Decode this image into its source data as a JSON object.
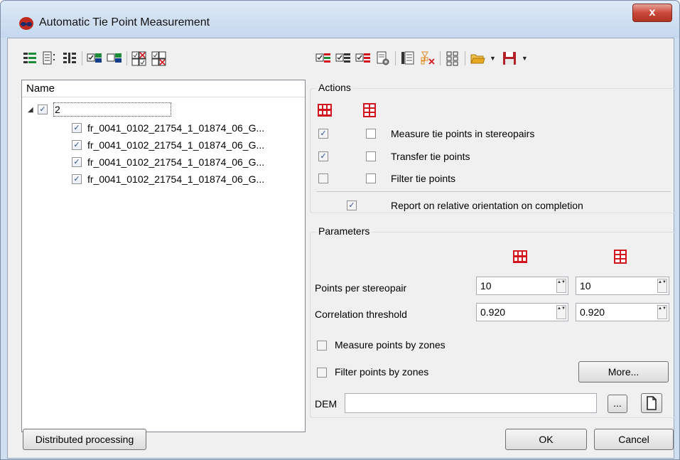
{
  "window": {
    "title": "Automatic Tie Point Measurement",
    "close_label": "x"
  },
  "tree": {
    "header": "Name",
    "root": {
      "label": "2",
      "checked": true,
      "expander": "◢"
    },
    "items": [
      {
        "label": "fr_0041_0102_21754_1_01874_06_G...",
        "checked": true
      },
      {
        "label": "fr_0041_0102_21754_1_01874_06_G...",
        "checked": true
      },
      {
        "label": "fr_0041_0102_21754_1_01874_06_G...",
        "checked": true
      },
      {
        "label": "fr_0041_0102_21754_1_01874_06_G...",
        "checked": true
      }
    ]
  },
  "actions": {
    "title": "Actions",
    "check_mark": "✓",
    "rows": [
      {
        "label": "Measure tie points in stereopairs",
        "col1": true,
        "col2": false
      },
      {
        "label": "Transfer tie points",
        "col1": true,
        "col2": false
      },
      {
        "label": "Filter tie points",
        "col1": false,
        "col2": false
      }
    ],
    "report_label": "Report on relative orientation on completion",
    "report_checked": true
  },
  "parameters": {
    "title": "Parameters",
    "points_label": "Points per stereopair",
    "points_values": [
      "10",
      "10"
    ],
    "corr_label": "Correlation threshold",
    "corr_values": [
      "0.920",
      "0.920"
    ],
    "measure_zones_label": "Measure points by zones",
    "filter_zones_label": "Filter points by zones",
    "more_label": "More...",
    "dem_label": "DEM",
    "dem_value": "",
    "browse_label": "..."
  },
  "footer": {
    "distributed_label": "Distributed processing",
    "ok_label": "OK",
    "cancel_label": "Cancel"
  },
  "spin_arrows": "▲▼",
  "colors": {
    "accent_red": "#d2141e",
    "check_blue": "#2a4f96",
    "folder": "#e8a820",
    "save": "#b3202a"
  }
}
